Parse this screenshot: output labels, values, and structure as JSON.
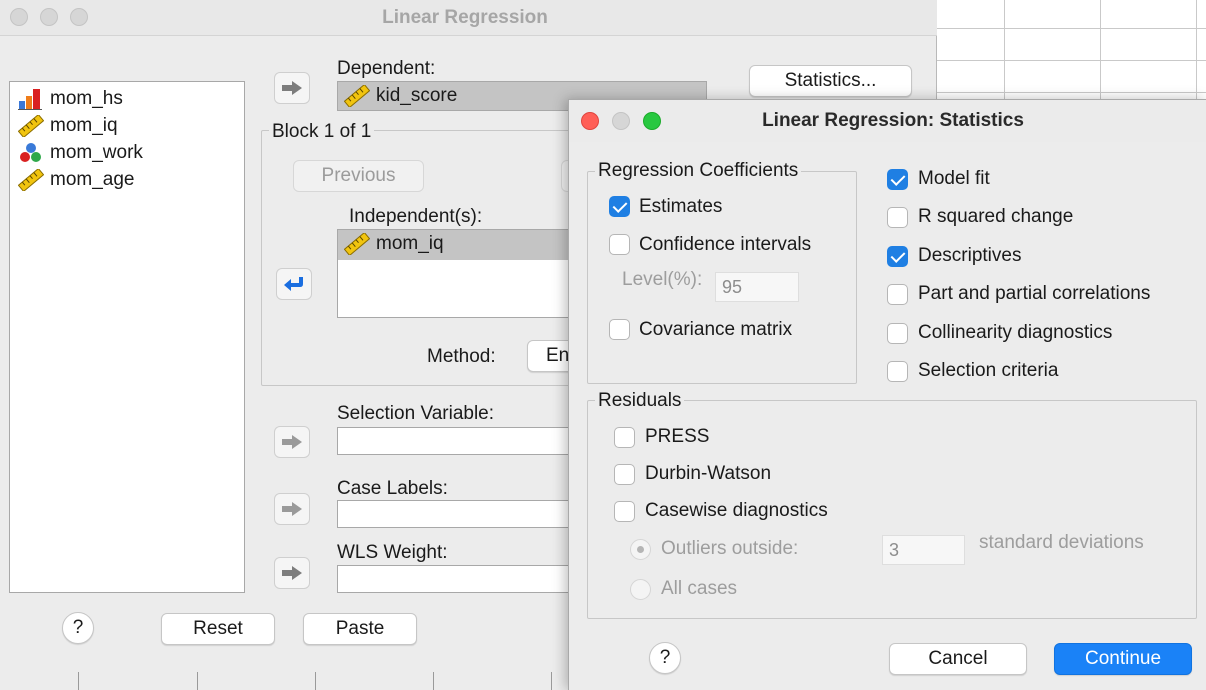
{
  "main_dialog": {
    "title": "Linear Regression",
    "variables": [
      {
        "name": "mom_hs",
        "icon": "nominal-bar-icon"
      },
      {
        "name": "mom_iq",
        "icon": "scale-ruler-icon"
      },
      {
        "name": "mom_work",
        "icon": "nominal-balls-icon"
      },
      {
        "name": "mom_age",
        "icon": "scale-ruler-icon"
      }
    ],
    "dependent_label": "Dependent:",
    "dependent_value": "kid_score",
    "block_label": "Block 1 of 1",
    "previous_label": "Previous",
    "independents_label": "Independent(s):",
    "independents": [
      "mom_iq"
    ],
    "method_label": "Method:",
    "method_value": "En",
    "selection_variable_label": "Selection Variable:",
    "case_labels_label": "Case Labels:",
    "wls_weight_label": "WLS Weight:",
    "statistics_button": "Statistics...",
    "help_button": "?",
    "reset_button": "Reset",
    "paste_button": "Paste"
  },
  "stats_dialog": {
    "title": "Linear Regression: Statistics",
    "coefficients_group": "Regression Coefficients",
    "estimates": {
      "label": "Estimates",
      "checked": true
    },
    "confidence_intervals": {
      "label": "Confidence intervals",
      "checked": false
    },
    "level_label": "Level(%):",
    "level_value": "95",
    "covariance_matrix": {
      "label": "Covariance matrix",
      "checked": false
    },
    "model_fit": {
      "label": "Model fit",
      "checked": true
    },
    "r_squared_change": {
      "label": "R squared change",
      "checked": false
    },
    "descriptives": {
      "label": "Descriptives",
      "checked": true
    },
    "part_partial": {
      "label": "Part and partial correlations",
      "checked": false
    },
    "collinearity": {
      "label": "Collinearity diagnostics",
      "checked": false
    },
    "selection_criteria": {
      "label": "Selection criteria",
      "checked": false
    },
    "residuals_group": "Residuals",
    "press": {
      "label": "PRESS",
      "checked": false
    },
    "durbin_watson": {
      "label": "Durbin-Watson",
      "checked": false
    },
    "casewise": {
      "label": "Casewise diagnostics",
      "checked": false
    },
    "outliers_label": "Outliers outside:",
    "outliers_value": "3",
    "std_dev_label": "standard deviations",
    "all_cases_label": "All cases",
    "help_button": "?",
    "cancel_button": "Cancel",
    "continue_button": "Continue"
  },
  "colors": {
    "accent": "#1a82f7",
    "checkbox_on": "#1f7fe3",
    "close": "#ff5f57",
    "zoom": "#28c840"
  }
}
